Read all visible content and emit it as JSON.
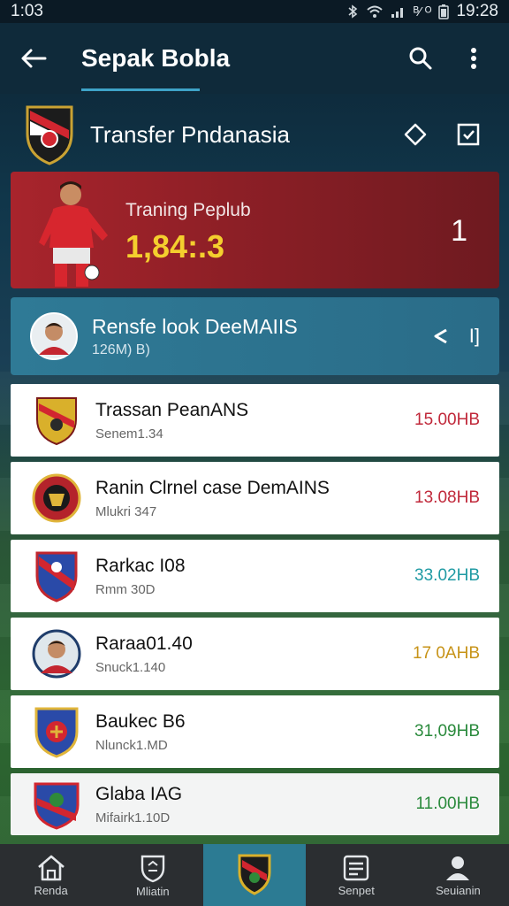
{
  "status": {
    "time_left": "1:03",
    "net": "ᴮ⁄ ᴼ",
    "time_right": "19:28"
  },
  "app": {
    "title": "Sepak Bobla"
  },
  "section": {
    "title": "Transfer Pndanasia"
  },
  "hero": {
    "label": "Traning Peplub",
    "value": "1,84:.3",
    "count": "1"
  },
  "banner": {
    "title": "Rensfe look DeeMAIIS",
    "subtitle": "126M) B)",
    "action_right": "I]"
  },
  "rows": [
    {
      "title": "Trassan PeanANS",
      "subtitle": "Senem1.34",
      "value": "15.00HB",
      "value_color": "#c0283a"
    },
    {
      "title": "Ranin Clrnel case DemAINS",
      "subtitle": "Mlukri 347",
      "value": "13.08HB",
      "value_color": "#c0283a"
    },
    {
      "title": "Rarkac I08",
      "subtitle": "Rmm 30D",
      "value": "33.02HB",
      "value_color": "#1f9aa3"
    },
    {
      "title": "Raraa01.40",
      "subtitle": "Snuck1.140",
      "value": "17 0AHB",
      "value_color": "#c79318"
    },
    {
      "title": "Baukec B6",
      "subtitle": "Nlunck1.MD",
      "value": "31,09HB",
      "value_color": "#2a8a3c"
    },
    {
      "title": "Glaba IAG",
      "subtitle": "Mifairk1.10D",
      "value": "11.00HB",
      "value_color": "#2a8a3c"
    }
  ],
  "nav": [
    {
      "label": "Renda",
      "icon": "home-icon"
    },
    {
      "label": "Mliatin",
      "icon": "shield-icon"
    },
    {
      "label": "",
      "icon": "club-badge-icon"
    },
    {
      "label": "Senpet",
      "icon": "document-icon"
    },
    {
      "label": "Seuianin",
      "icon": "person-icon"
    }
  ],
  "colors": {
    "accent": "#2c7b93",
    "hero_value": "#f4cf2e"
  }
}
